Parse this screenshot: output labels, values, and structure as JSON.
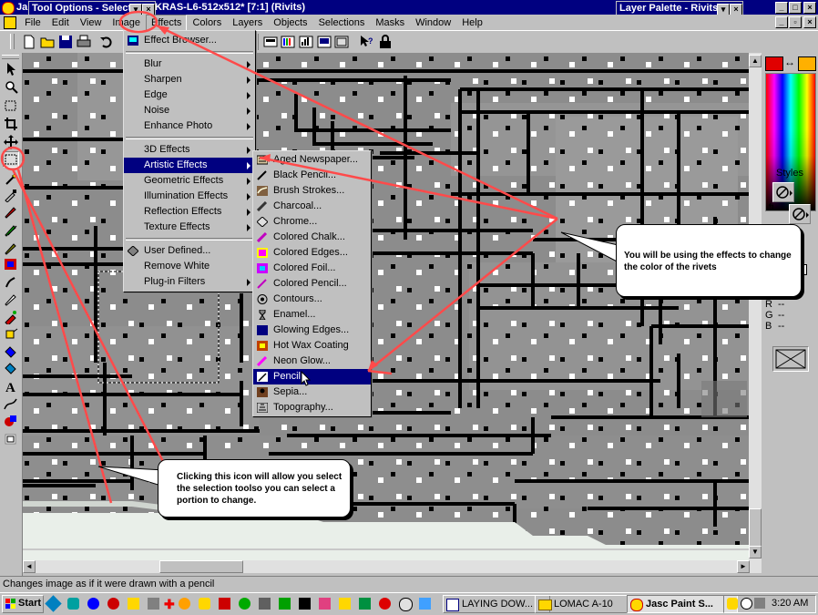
{
  "app": {
    "main_title_fragment": "Ja",
    "doc_title_fragment": "KRAS-L6-512x512* [7:1] (Rivits)"
  },
  "tool_options": {
    "title": "Tool Options - Select"
  },
  "layer_palette": {
    "title": "Layer Palette - Rivits"
  },
  "menubar": [
    "File",
    "Edit",
    "View",
    "Image",
    "Effects",
    "Colors",
    "Layers",
    "Objects",
    "Selections",
    "Masks",
    "Window",
    "Help"
  ],
  "effects_menu": {
    "browser": "Effect Browser...",
    "group1": [
      "Blur",
      "Sharpen",
      "Edge",
      "Noise",
      "Enhance Photo"
    ],
    "group2": [
      "3D Effects",
      "Artistic Effects",
      "Geometric Effects",
      "Illumination Effects",
      "Reflection Effects",
      "Texture Effects"
    ],
    "group3": [
      "User Defined...",
      "Remove White",
      "Plug-in Filters"
    ]
  },
  "artistic_menu": [
    "Aged Newspaper...",
    "Black Pencil...",
    "Brush Strokes...",
    "Charcoal...",
    "Chrome...",
    "Colored Chalk...",
    "Colored Edges...",
    "Colored Foil...",
    "Colored Pencil...",
    "Contours...",
    "Enamel...",
    "Glowing Edges...",
    "Hot Wax Coating",
    "Neon Glow...",
    "Pencil...",
    "Sepia...",
    "Topography..."
  ],
  "callouts": {
    "effects": "You will be using the effects to change the color of the rivets",
    "select_tool": "Clicking this icon will allow you select the selection toolso you can select a portion to change."
  },
  "right_panel": {
    "styles_label": "Styles",
    "rgb_labels": [
      "R",
      "G",
      "B"
    ],
    "rgb_values": [
      "--",
      "--",
      "--"
    ]
  },
  "status_text": "Changes image as if it were drawn with a pencil",
  "taskbar": {
    "start": "Start",
    "tasks": [
      "LAYING DOW...",
      "LOMAC A-10",
      "Jasc Paint S..."
    ],
    "clock": "3:20 AM"
  },
  "colors": {
    "titlebar": "#000080",
    "annotation": "#ff4040",
    "canvas_gray": "#8a8a8a"
  }
}
